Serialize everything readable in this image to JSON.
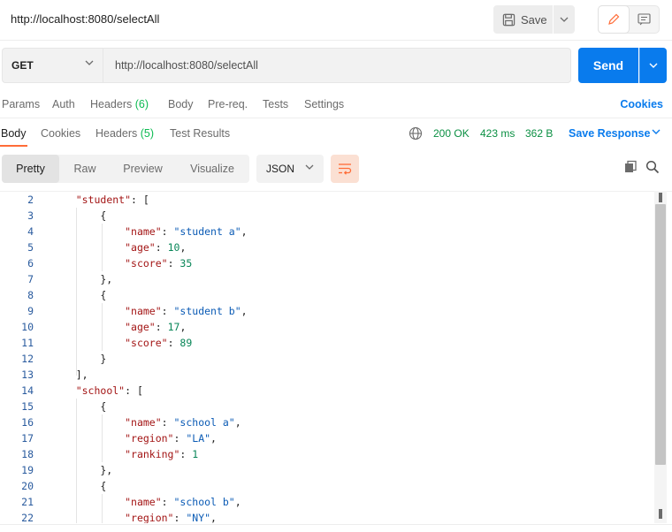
{
  "request": {
    "title": "http://localhost:8080/selectAll",
    "save_label": "Save",
    "method": "GET",
    "url": "http://localhost:8080/selectAll",
    "send_label": "Send"
  },
  "request_tabs": [
    {
      "label": "Params",
      "count": ""
    },
    {
      "label": "Auth",
      "count": ""
    },
    {
      "label": "Headers",
      "count": "(6)"
    },
    {
      "label": "Body",
      "count": ""
    },
    {
      "label": "Pre-req.",
      "count": ""
    },
    {
      "label": "Tests",
      "count": ""
    },
    {
      "label": "Settings",
      "count": ""
    }
  ],
  "cookies_label": "Cookies",
  "response_tabs": [
    {
      "label": "Body",
      "count": "",
      "active": true
    },
    {
      "label": "Cookies",
      "count": ""
    },
    {
      "label": "Headers",
      "count": "(5)"
    },
    {
      "label": "Test Results",
      "count": ""
    }
  ],
  "response_status": {
    "status": "200 OK",
    "time": "423 ms",
    "size": "362 B",
    "save_response_label": "Save Response"
  },
  "view_tabs": [
    {
      "label": "Pretty",
      "active": true
    },
    {
      "label": "Raw"
    },
    {
      "label": "Preview"
    },
    {
      "label": "Visualize"
    }
  ],
  "format_select": "JSON",
  "colors": {
    "accent_blue": "#097bed",
    "status_green": "#0a8f42",
    "count_green": "#0cbb52",
    "orange_active": "#ff6c37"
  },
  "code_lines": [
    {
      "num": "2",
      "text": "    \"student\": ["
    },
    {
      "num": "3",
      "text": "        {"
    },
    {
      "num": "4",
      "text": "            \"name\": \"student a\","
    },
    {
      "num": "5",
      "text": "            \"age\": 10,"
    },
    {
      "num": "6",
      "text": "            \"score\": 35"
    },
    {
      "num": "7",
      "text": "        },"
    },
    {
      "num": "8",
      "text": "        {"
    },
    {
      "num": "9",
      "text": "            \"name\": \"student b\","
    },
    {
      "num": "10",
      "text": "            \"age\": 17,"
    },
    {
      "num": "11",
      "text": "            \"score\": 89"
    },
    {
      "num": "12",
      "text": "        }"
    },
    {
      "num": "13",
      "text": "    ],"
    },
    {
      "num": "14",
      "text": "    \"school\": ["
    },
    {
      "num": "15",
      "text": "        {"
    },
    {
      "num": "16",
      "text": "            \"name\": \"school a\","
    },
    {
      "num": "17",
      "text": "            \"region\": \"LA\","
    },
    {
      "num": "18",
      "text": "            \"ranking\": 1"
    },
    {
      "num": "19",
      "text": "        },"
    },
    {
      "num": "20",
      "text": "        {"
    },
    {
      "num": "21",
      "text": "            \"name\": \"school b\","
    },
    {
      "num": "22",
      "text": "            \"region\": \"NY\","
    }
  ]
}
